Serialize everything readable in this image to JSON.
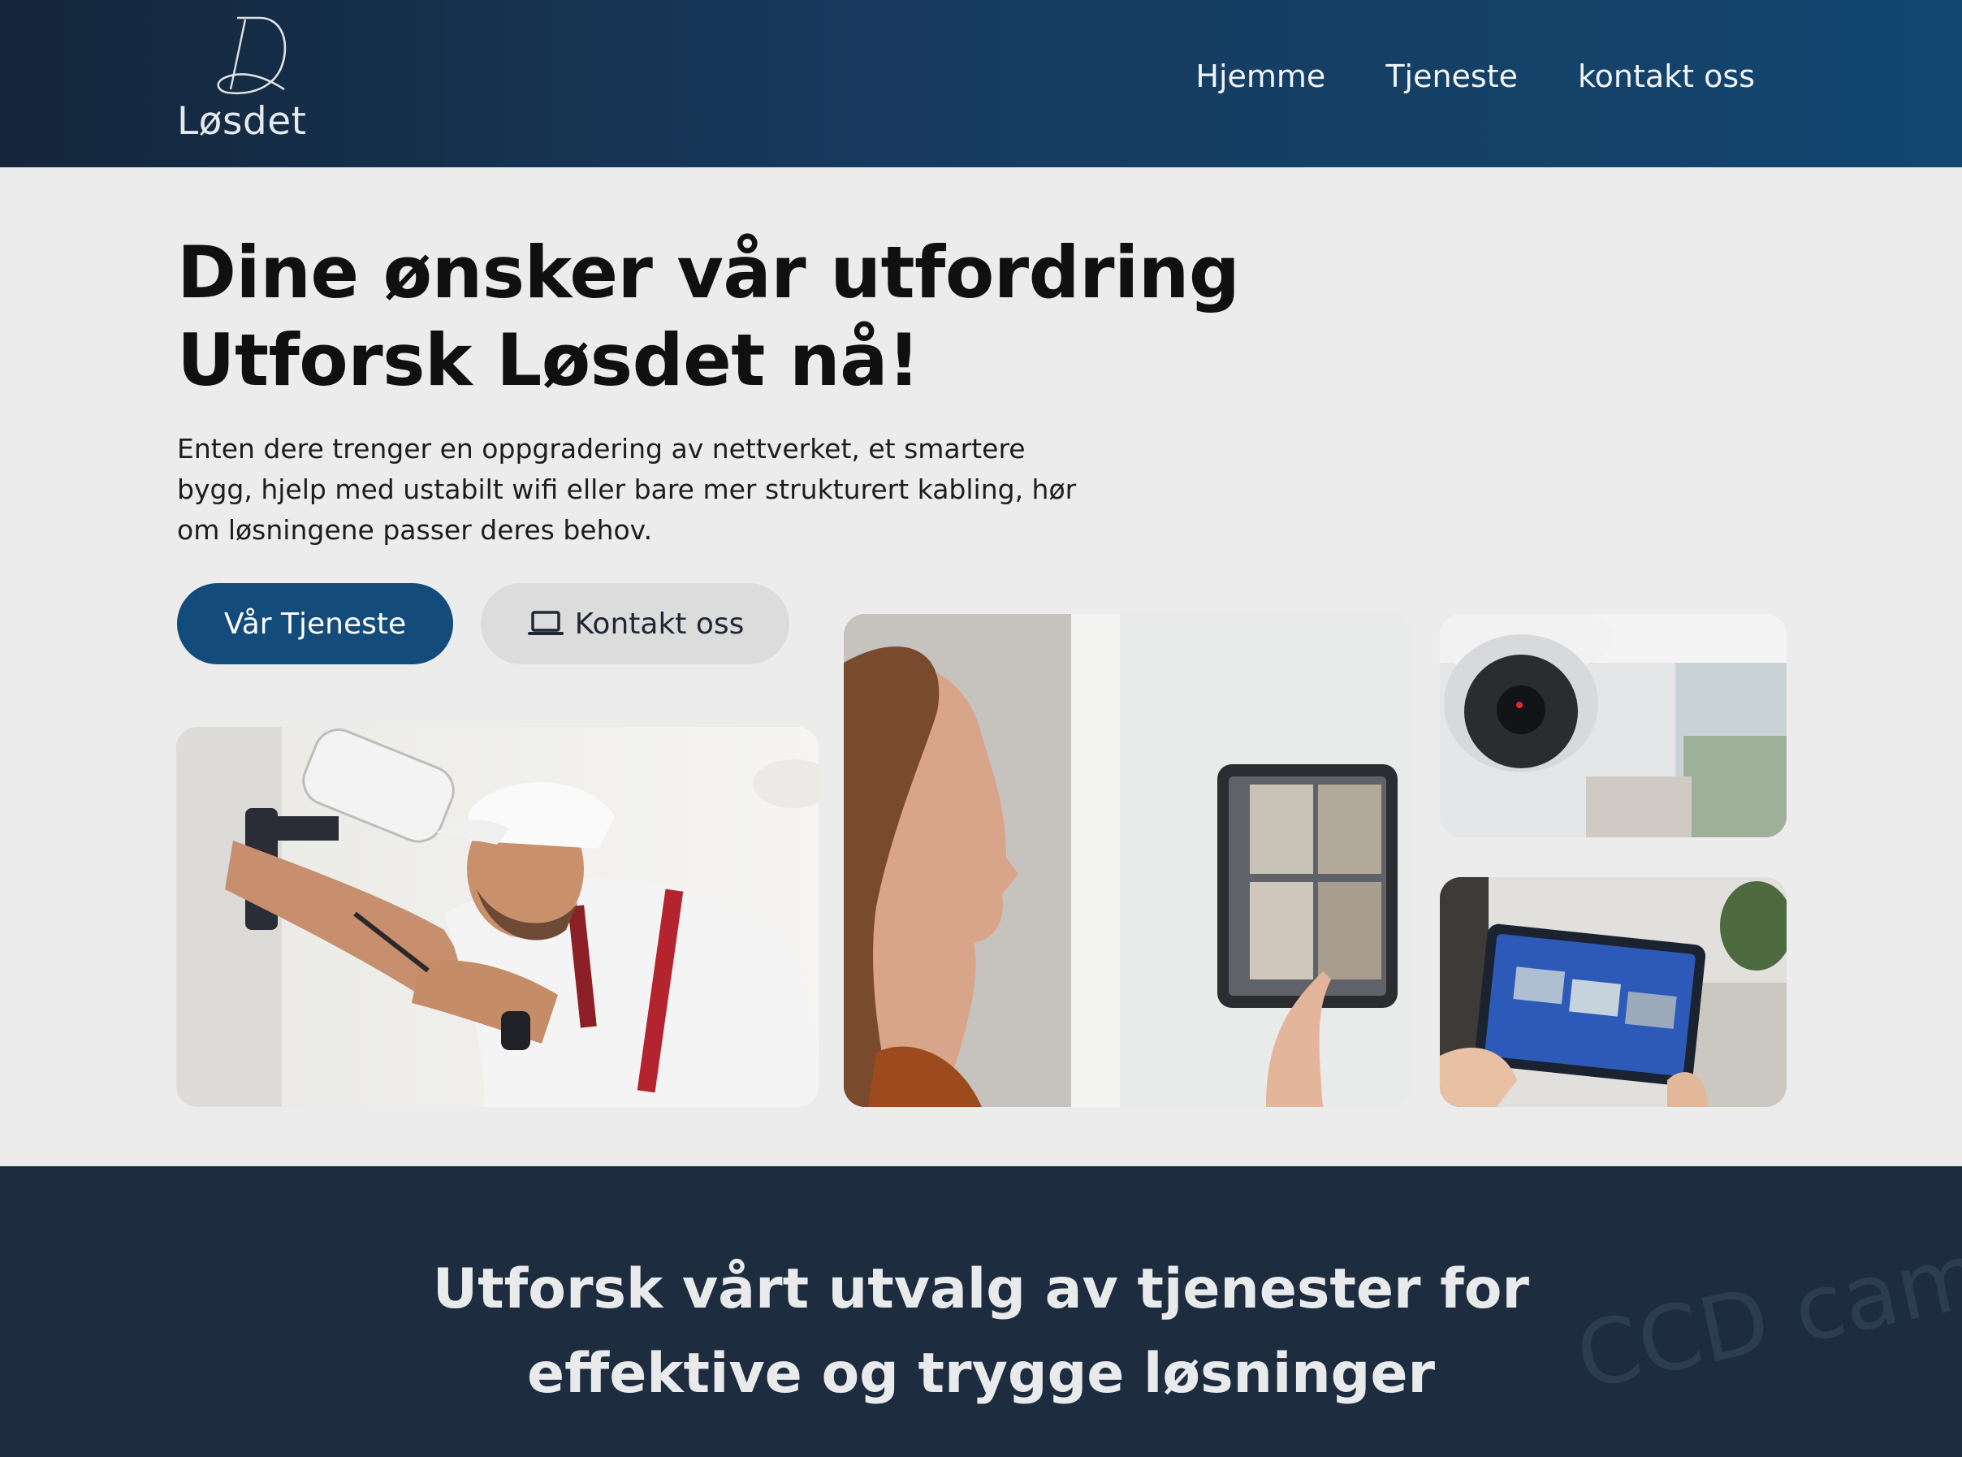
{
  "header": {
    "logo_text": "Løsdet",
    "nav": [
      "Hjemme",
      "Tjeneste",
      "kontakt oss"
    ]
  },
  "hero": {
    "title_line1": "Dine ønsker vår utfordring",
    "title_line2": "Utforsk Løsdet nå!",
    "description": "Enten dere trenger en oppgradering av nettverket, et smartere bygg, hjelp med ustabilt wifi eller bare mer strukturert kabling, hør om løsningene passer deres behov.",
    "primary_button": "Vår Tjeneste",
    "secondary_button": "Kontakt oss",
    "secondary_button_icon": "laptop-icon"
  },
  "gallery": [
    {
      "name": "technician-installing-camera-photo"
    },
    {
      "name": "woman-touch-panel-photo"
    },
    {
      "name": "dome-camera-photo"
    },
    {
      "name": "tablet-security-app-photo"
    }
  ],
  "band": {
    "title_line1": "Utforsk vårt utvalg av tjenester for",
    "title_line2": "effektive og trygge løsninger",
    "background_color": "#1d2d3f"
  },
  "colors": {
    "header_gradient_start": "#14263b",
    "header_gradient_end": "#12466f",
    "primary_button": "#134b7b",
    "page_background": "#ececec"
  }
}
